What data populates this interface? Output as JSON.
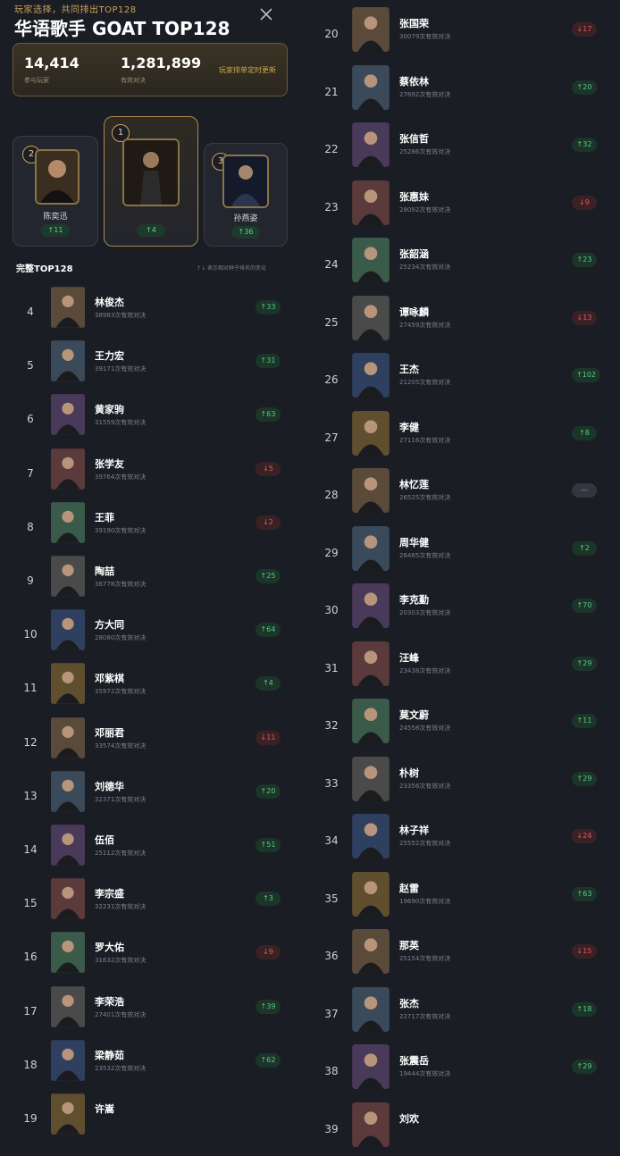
{
  "header": {
    "subtitle": "玩家选择，共同排出TOP128",
    "title": "华语歌手 GOAT TOP128"
  },
  "stats": {
    "players_value": "14,414",
    "players_label": "参与玩家",
    "battles_value": "1,281,899",
    "battles_label": "有效对决",
    "note": "玩家排单定时更新"
  },
  "podium": [
    {
      "rank": "2",
      "name": "陈奕迅",
      "change": "↑11"
    },
    {
      "rank": "1",
      "name": "",
      "change": "↑4"
    },
    {
      "rank": "3",
      "name": "孙燕姿",
      "change": "↑36"
    }
  ],
  "section": {
    "title": "完整TOP128",
    "note": "↑↓ 表示相对种子排名的变化"
  },
  "left_list": [
    {
      "rank": "4",
      "name": "林俊杰",
      "count": "38983次有效对决",
      "change": "↑33",
      "dir": "up"
    },
    {
      "rank": "5",
      "name": "王力宏",
      "count": "39171次有效对决",
      "change": "↑31",
      "dir": "up"
    },
    {
      "rank": "6",
      "name": "黄家驹",
      "count": "31559次有效对决",
      "change": "↑63",
      "dir": "up"
    },
    {
      "rank": "7",
      "name": "张学友",
      "count": "39764次有效对决",
      "change": "↓5",
      "dir": "down"
    },
    {
      "rank": "8",
      "name": "王菲",
      "count": "39190次有效对决",
      "change": "↓2",
      "dir": "down"
    },
    {
      "rank": "9",
      "name": "陶喆",
      "count": "36778次有效对决",
      "change": "↑25",
      "dir": "up"
    },
    {
      "rank": "10",
      "name": "方大同",
      "count": "28080次有效对决",
      "change": "↑64",
      "dir": "up"
    },
    {
      "rank": "11",
      "name": "邓紫棋",
      "count": "35972次有效对决",
      "change": "↑4",
      "dir": "up"
    },
    {
      "rank": "12",
      "name": "邓丽君",
      "count": "33574次有效对决",
      "change": "↓11",
      "dir": "down"
    },
    {
      "rank": "13",
      "name": "刘德华",
      "count": "32371次有效对决",
      "change": "↑20",
      "dir": "up"
    },
    {
      "rank": "14",
      "name": "伍佰",
      "count": "25112次有效对决",
      "change": "↑51",
      "dir": "up"
    },
    {
      "rank": "15",
      "name": "李宗盛",
      "count": "32231次有效对决",
      "change": "↑3",
      "dir": "up"
    },
    {
      "rank": "16",
      "name": "罗大佑",
      "count": "31632次有效对决",
      "change": "↓9",
      "dir": "down"
    },
    {
      "rank": "17",
      "name": "李荣浩",
      "count": "27401次有效对决",
      "change": "↑39",
      "dir": "up"
    },
    {
      "rank": "18",
      "name": "梁静茹",
      "count": "23532次有效对决",
      "change": "↑62",
      "dir": "up"
    },
    {
      "rank": "19",
      "name": "许嵩",
      "count": "",
      "change": "",
      "dir": "up"
    }
  ],
  "right_list": [
    {
      "rank": "20",
      "name": "张国荣",
      "count": "30079次有效对决",
      "change": "↓17",
      "dir": "down"
    },
    {
      "rank": "21",
      "name": "蔡依林",
      "count": "27692次有效对决",
      "change": "↑20",
      "dir": "up"
    },
    {
      "rank": "22",
      "name": "张信哲",
      "count": "25286次有效对决",
      "change": "↑32",
      "dir": "up"
    },
    {
      "rank": "23",
      "name": "张惠妹",
      "count": "28092次有效对决",
      "change": "↓9",
      "dir": "down"
    },
    {
      "rank": "24",
      "name": "张韶涵",
      "count": "25234次有效对决",
      "change": "↑23",
      "dir": "up"
    },
    {
      "rank": "25",
      "name": "谭咏麟",
      "count": "27459次有效对决",
      "change": "↓13",
      "dir": "down"
    },
    {
      "rank": "26",
      "name": "王杰",
      "count": "21205次有效对决",
      "change": "↑102",
      "dir": "up"
    },
    {
      "rank": "27",
      "name": "李健",
      "count": "27116次有效对决",
      "change": "↑8",
      "dir": "up"
    },
    {
      "rank": "28",
      "name": "林忆莲",
      "count": "26525次有效对决",
      "change": "—",
      "dir": "same"
    },
    {
      "rank": "29",
      "name": "周华健",
      "count": "26465次有效对决",
      "change": "↑2",
      "dir": "up"
    },
    {
      "rank": "30",
      "name": "李克勤",
      "count": "20303次有效对决",
      "change": "↑70",
      "dir": "up"
    },
    {
      "rank": "31",
      "name": "汪峰",
      "count": "23438次有效对决",
      "change": "↑29",
      "dir": "up"
    },
    {
      "rank": "32",
      "name": "莫文蔚",
      "count": "24558次有效对决",
      "change": "↑11",
      "dir": "up"
    },
    {
      "rank": "33",
      "name": "朴树",
      "count": "23356次有效对决",
      "change": "↑29",
      "dir": "up"
    },
    {
      "rank": "34",
      "name": "林子祥",
      "count": "25552次有效对决",
      "change": "↓24",
      "dir": "down"
    },
    {
      "rank": "35",
      "name": "赵雷",
      "count": "19690次有效对决",
      "change": "↑63",
      "dir": "up"
    },
    {
      "rank": "36",
      "name": "那英",
      "count": "25154次有效对决",
      "change": "↓15",
      "dir": "down"
    },
    {
      "rank": "37",
      "name": "张杰",
      "count": "22717次有效对决",
      "change": "↑18",
      "dir": "up"
    },
    {
      "rank": "38",
      "name": "张震岳",
      "count": "19444次有效对决",
      "change": "↑29",
      "dir": "up"
    },
    {
      "rank": "39",
      "name": "刘欢",
      "count": "",
      "change": "",
      "dir": "up"
    }
  ],
  "colors": {
    "background": "#1a1d24",
    "gold_accent": "#c9a35a",
    "up_green": "#58c985",
    "down_red": "#e0575c"
  }
}
